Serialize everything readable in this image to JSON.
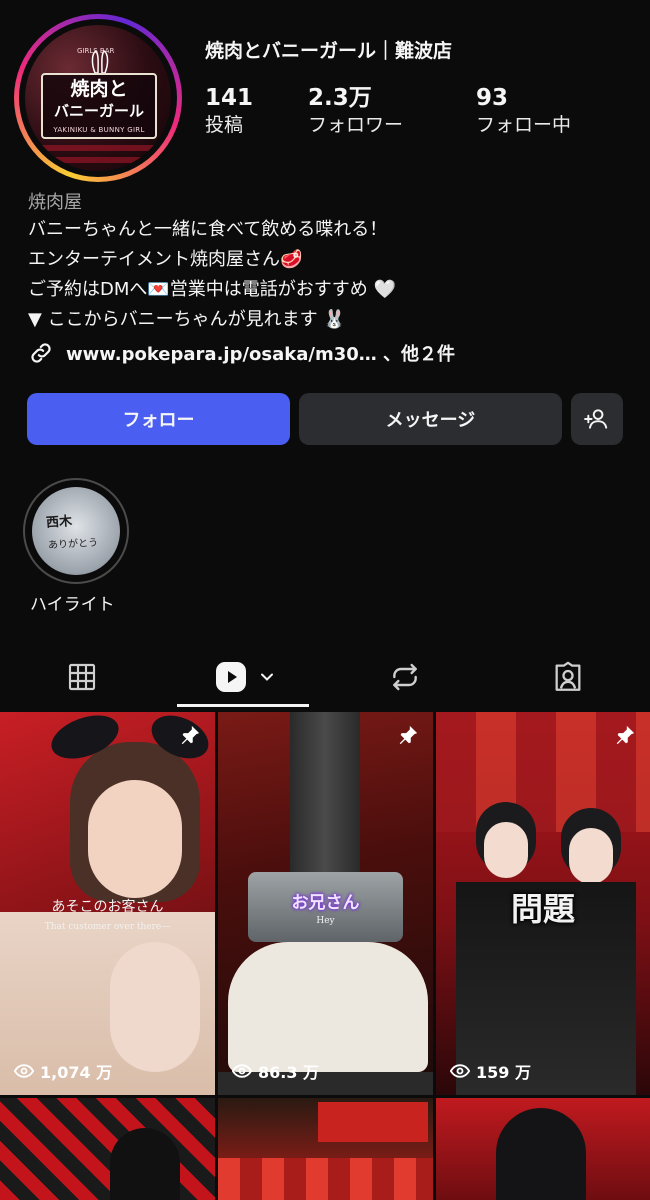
{
  "profile": {
    "name": "焼肉とバニーガール｜難波店",
    "avatar": {
      "logo_top": "GIRLS BAR",
      "logo_main_1": "焼肉と",
      "logo_main_2": "バニーガール",
      "logo_sub": "YAKINIKU & BUNNY GIRL"
    },
    "stats": [
      {
        "value": "141",
        "label": "投稿"
      },
      {
        "value": "2.3万",
        "label": "フォロワー"
      },
      {
        "value": "93",
        "label": "フォロー中"
      }
    ]
  },
  "bio": {
    "category": "焼肉屋",
    "lines": [
      "バニーちゃんと一緒に食べて飲める喋れる！",
      "エンターテイメント焼肉屋さん🥩",
      "ご予約はDMへ💌営業中は電話がおすすめ 🤍",
      "▼ ここからバニーちゃんが見れます 🐰"
    ],
    "link": "www.pokepara.jp/osaka/m30… 、他２件"
  },
  "actions": {
    "follow": "フォロー",
    "message": "メッセージ",
    "add_icon": "add-person-icon"
  },
  "highlights": [
    {
      "label": "ハイライト",
      "scribble_1": "西木",
      "scribble_2": "ありがとう"
    }
  ],
  "tabs": [
    {
      "icon": "grid-icon"
    },
    {
      "icon": "reels-icon",
      "active": true
    },
    {
      "icon": "repost-icon"
    },
    {
      "icon": "tagged-icon"
    }
  ],
  "reels": [
    {
      "caption_ja": "あそこのお客さん",
      "caption_en": "That customer over there—",
      "views": "1,074 万",
      "pinned": true
    },
    {
      "caption_ja": "お兄さん",
      "caption_en": "Hey",
      "views": "86.3 万",
      "pinned": true
    },
    {
      "caption_ja": "問題",
      "caption_en": "",
      "views": "159 万",
      "pinned": true
    }
  ],
  "colors": {
    "follow_button": "#4a5ef2",
    "secondary_button": "#2b2d31",
    "background": "#0b0b0b"
  }
}
